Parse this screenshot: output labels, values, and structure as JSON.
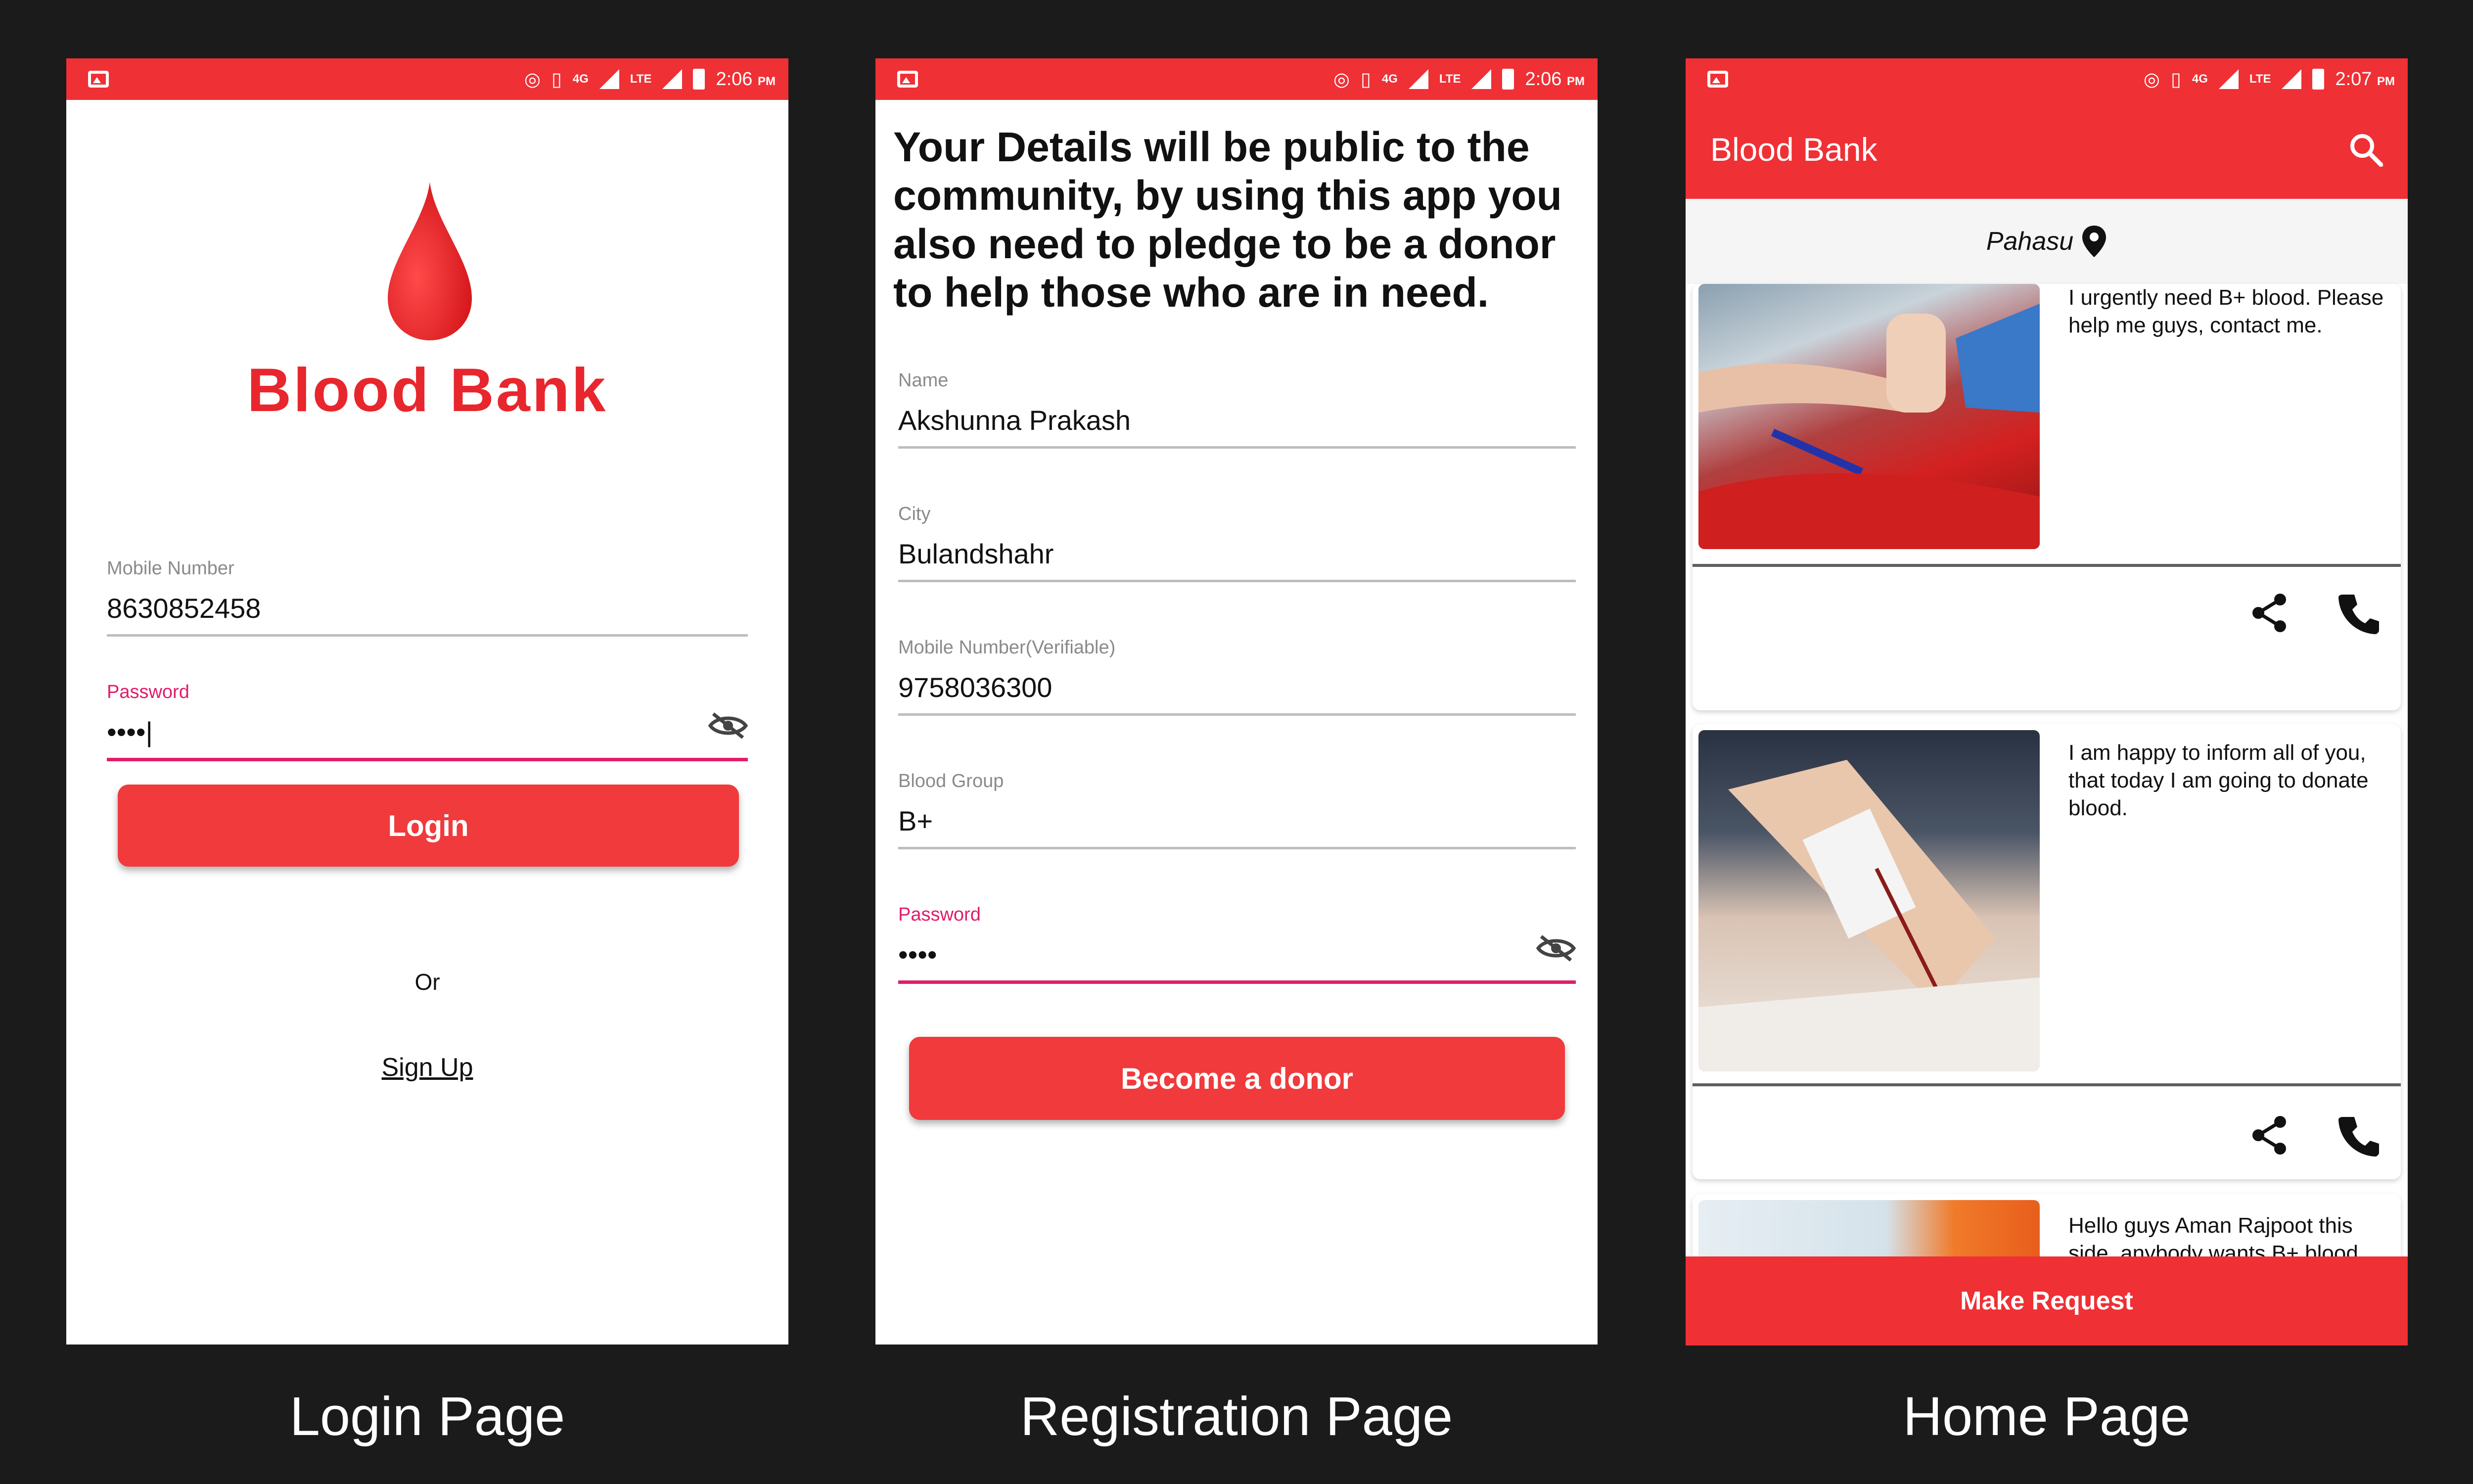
{
  "status_bar": {
    "time_login": "2:06",
    "time_register": "2:06",
    "time_home": "2:07",
    "ampm": "PM",
    "lte": "LTE",
    "net": "4G"
  },
  "login": {
    "brand": "Blood Bank",
    "mobile_label": "Mobile Number",
    "mobile_value": "8630852458",
    "password_label": "Password",
    "password_value": "••••|",
    "login_button": "Login",
    "or_text": "Or",
    "signup_link": "Sign Up"
  },
  "register": {
    "notice": "Your Details will be public to the community, by using this app you also need to pledge to be a donor to help those who are in need.",
    "fields": [
      {
        "label": "Name",
        "value": "Akshunna Prakash"
      },
      {
        "label": "City",
        "value": "Bulandshahr"
      },
      {
        "label": "Mobile Number(Verifiable)",
        "value": "9758036300"
      },
      {
        "label": "Blood Group",
        "value": "B+"
      }
    ],
    "password_label": "Password",
    "password_value": "••••",
    "donor_button": "Become a donor"
  },
  "home": {
    "title": "Blood Bank",
    "location": "Pahasu",
    "posts": [
      {
        "text": "I urgently need B+ blood. Please help me guys, contact me."
      },
      {
        "text": "I am happy to inform all of you, that today I am going to donate blood."
      },
      {
        "text": "Hello guys Aman Rajpoot this side, anybody wants B+ blood just call me."
      }
    ],
    "make_request": "Make Request"
  },
  "captions": {
    "login": "Login Page",
    "register": "Registration Page",
    "home": "Home Page"
  },
  "colors": {
    "primary": "#ef3035",
    "accent": "#e11d6b",
    "background": "#1b1b1b"
  },
  "icons": [
    "image-icon",
    "hotspot-icon",
    "vibrate-icon",
    "wifi-calling-icon",
    "signal-icon",
    "battery-icon",
    "eye-off-icon",
    "search-icon",
    "location-pin-icon",
    "share-icon",
    "phone-icon"
  ]
}
